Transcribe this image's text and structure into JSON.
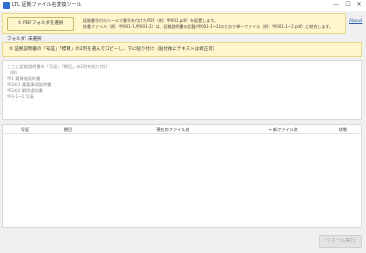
{
  "window": {
    "title": "LTL 証拠ファイル名変換ツール",
    "controls": {
      "minimize": "—",
      "maximize": "☐",
      "close": "✕"
    }
  },
  "step1": {
    "button_label": "① PDFフォルダを選択",
    "line1": "証拠番号付与ツールで番号を付けたPDF（例：甲001.pdf）を配置します。",
    "line2": "枝番ファイル（例：甲001-1,甲001-2）は、証拠説明書の記載(甲001-1~2)のとおり単一ファイル（例：甲001-1~2.pdf）に結合します。"
  },
  "about_link": "About",
  "folder": {
    "label": "フォルダ: 未選択"
  },
  "step2": {
    "instruction": "② 証拠説明書の「号証」「標目」の2列を選んでコピーし、下に貼り付け（貼付後にテキストは修正可）"
  },
  "paste_area": {
    "placeholder_lines": [
      "ここに証拠説明書の「号証」「標目」の2列を貼り付け",
      "（例）",
      "甲1 賃貸借契約書",
      "甲2の1 重要事項説明書",
      "甲2の2 解除通知書",
      "甲3-1~2 写真"
    ]
  },
  "table": {
    "columns": [
      "号証",
      "標目",
      "現在のファイル名",
      "→ 新ファイル名",
      "状態"
    ],
    "rows": []
  },
  "run_button": {
    "label": "リネーム実行"
  }
}
